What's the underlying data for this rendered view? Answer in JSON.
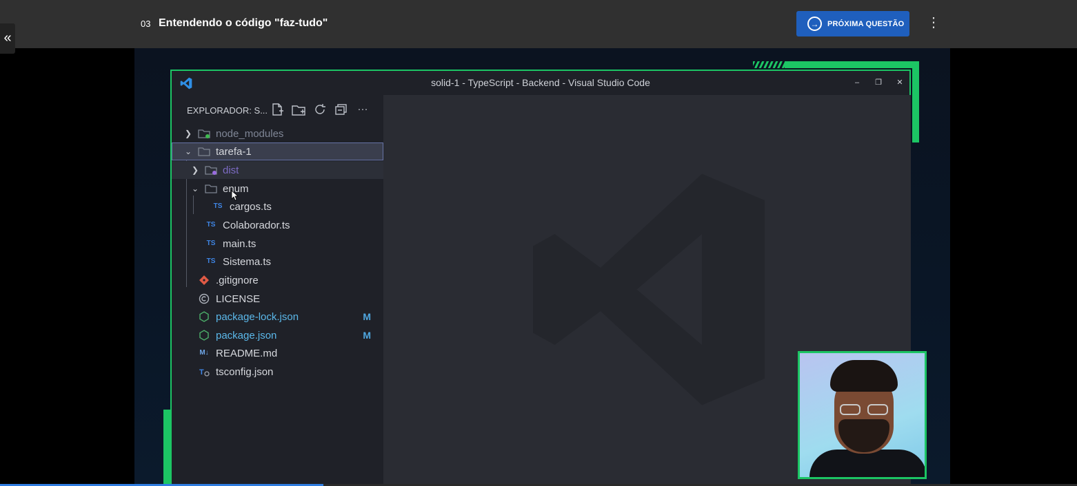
{
  "header": {
    "collapse_icon": "double-chevron-left-icon",
    "lesson_number": "03",
    "lesson_title": "Entendendo o código \"faz-tudo\"",
    "next_button_label": "PRÓXIMA QUESTÃO",
    "next_button_icon": "arrow-circle-right-icon",
    "menu_icon": "kebab-menu-icon",
    "accent_color": "#1f5fbd"
  },
  "video": {
    "progress_fraction": 0.3,
    "frame_color": "#1cc564"
  },
  "vscode": {
    "window_title": "solid-1 - TypeScript - Backend - Visual Studio Code",
    "explorer_header": "EXPLORADOR: S...",
    "explorer_actions": [
      "new-file-icon",
      "new-folder-icon",
      "refresh-icon",
      "collapse-all-icon",
      "more-icon"
    ],
    "tree": [
      {
        "name": "node_modules",
        "type": "folder",
        "expanded": false,
        "level": 0
      },
      {
        "name": "tarefa-1",
        "type": "folder",
        "expanded": true,
        "level": 0,
        "selected": true
      },
      {
        "name": "dist",
        "type": "folder",
        "expanded": false,
        "level": 1
      },
      {
        "name": "enum",
        "type": "folder",
        "expanded": true,
        "level": 1
      },
      {
        "name": "cargos.ts",
        "type": "ts",
        "level": 2
      },
      {
        "name": "Colaborador.ts",
        "type": "ts",
        "level": 1
      },
      {
        "name": "main.ts",
        "type": "ts",
        "level": 1
      },
      {
        "name": "Sistema.ts",
        "type": "ts",
        "level": 1
      },
      {
        "name": ".gitignore",
        "type": "git",
        "level": 0
      },
      {
        "name": "LICENSE",
        "type": "license",
        "level": 0
      },
      {
        "name": "package-lock.json",
        "type": "json",
        "level": 0,
        "badge": "M"
      },
      {
        "name": "package.json",
        "type": "json",
        "level": 0,
        "badge": "M"
      },
      {
        "name": "README.md",
        "type": "md",
        "level": 0
      },
      {
        "name": "tsconfig.json",
        "type": "tsconfig",
        "level": 0
      }
    ],
    "ts_icon_text": "TS",
    "md_icon_text": "M↓"
  }
}
